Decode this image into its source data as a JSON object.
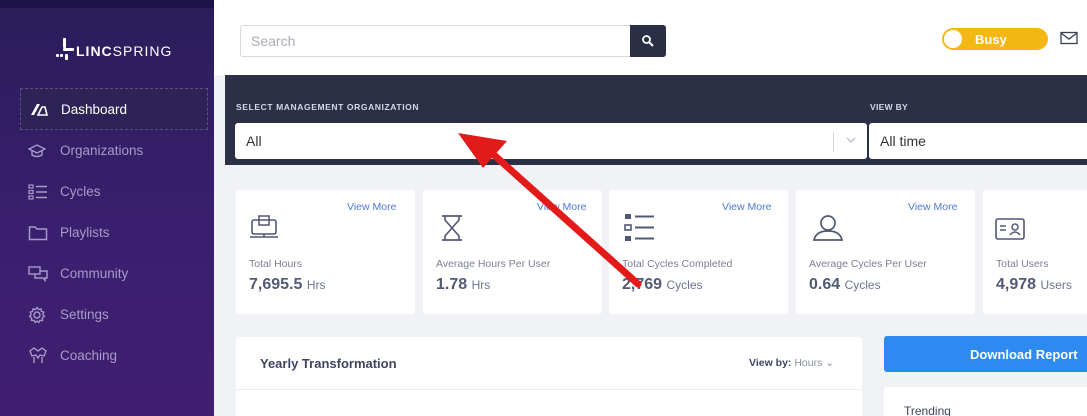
{
  "brand": {
    "logo_text_bold": "LINC",
    "logo_text_rest": "SPRING"
  },
  "sidebar": {
    "items": [
      {
        "label": "Dashboard",
        "icon": "gauge-icon",
        "active": true
      },
      {
        "label": "Organizations",
        "icon": "graduation-cap-icon",
        "active": false
      },
      {
        "label": "Cycles",
        "icon": "list-icon",
        "active": false
      },
      {
        "label": "Playlists",
        "icon": "folder-icon",
        "active": false
      },
      {
        "label": "Community",
        "icon": "chat-bubbles-icon",
        "active": false
      },
      {
        "label": "Settings",
        "icon": "gear-icon",
        "active": false
      },
      {
        "label": "Coaching",
        "icon": "coaching-hands-icon",
        "active": false
      }
    ]
  },
  "topbar": {
    "search_placeholder": "Search",
    "status_label": "Busy",
    "status_color": "#f5b713"
  },
  "filters": {
    "org_label": "SELECT MANAGEMENT ORGANIZATION",
    "org_value": "All",
    "viewby_label": "VIEW BY",
    "viewby_value": "All time"
  },
  "stats": [
    {
      "label": "Total Hours",
      "value": "7,695.5",
      "unit": "Hrs",
      "more": "View More",
      "icon": "monitor-learning-icon"
    },
    {
      "label": "Average Hours Per User",
      "value": "1.78",
      "unit": "Hrs",
      "more": "View More",
      "icon": "hourglass-icon"
    },
    {
      "label": "Total Cycles Completed",
      "value": "2,769",
      "unit": "Cycles",
      "more": "View More",
      "icon": "checklist-icon"
    },
    {
      "label": "Average Cycles Per User",
      "value": "0.64",
      "unit": "Cycles",
      "more": "View More",
      "icon": "user-outline-icon"
    },
    {
      "label": "Total Users",
      "value": "4,978",
      "unit": "Users",
      "more": "",
      "icon": "id-card-icon"
    }
  ],
  "yearly": {
    "title": "Yearly Transformation",
    "viewby_label": "View by:",
    "viewby_value": "Hours"
  },
  "download_label": "Download Report",
  "trending_title": "Trending",
  "colors": {
    "sidebar": "#2a1d5a",
    "accent_blue": "#2c8af1",
    "filterbar": "#2c3047",
    "annotation_arrow": "#e31a1a"
  }
}
